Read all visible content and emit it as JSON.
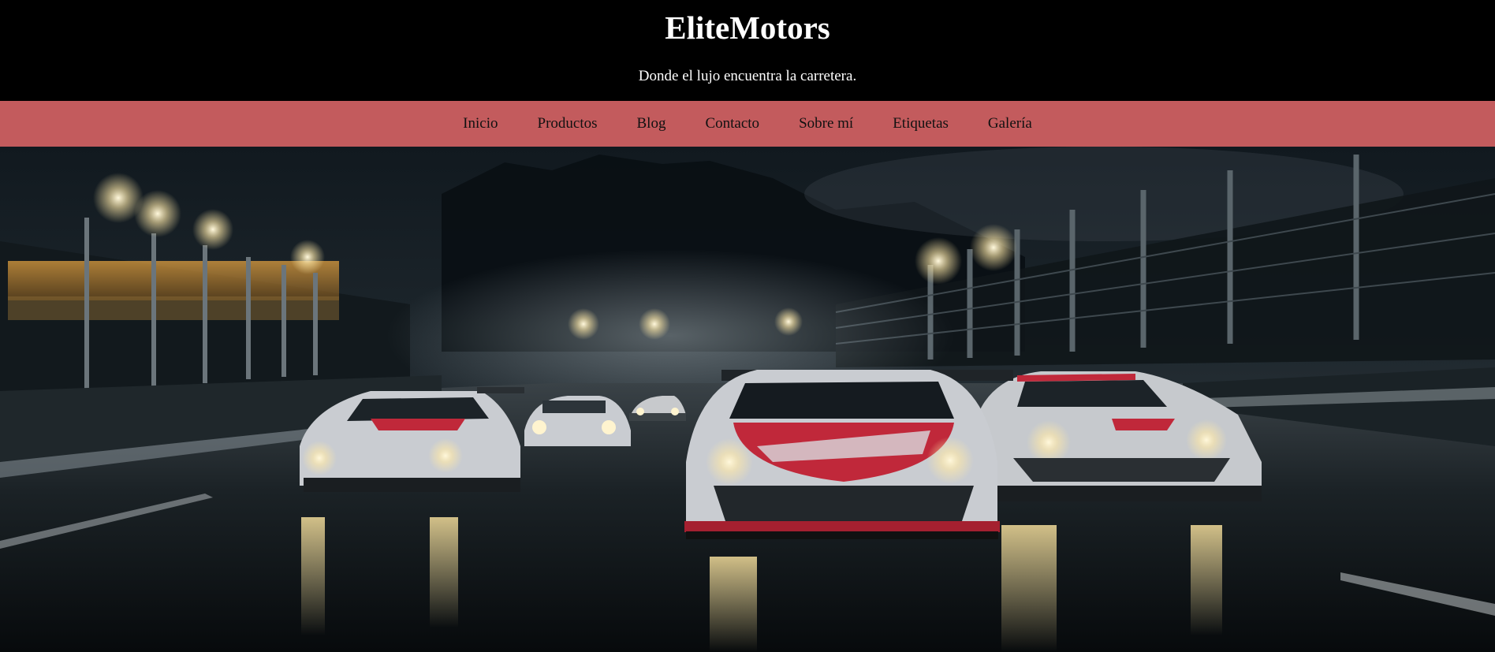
{
  "site": {
    "title": "EliteMotors",
    "tagline": "Donde el lujo encuentra la carretera."
  },
  "nav": {
    "items": [
      "Inicio",
      "Productos",
      "Blog",
      "Contacto",
      "Sobre mí",
      "Etiquetas",
      "Galería"
    ]
  },
  "hero": {
    "image_subject": "race-cars-night-track",
    "colors": {
      "accent_red": "#c0283a",
      "car_silver": "#c9ccd1",
      "sky": "#0d161c"
    }
  },
  "theme": {
    "header_bg": "#000000",
    "nav_bg": "#c35b5d",
    "nav_text": "#111111",
    "header_text": "#ffffff"
  }
}
